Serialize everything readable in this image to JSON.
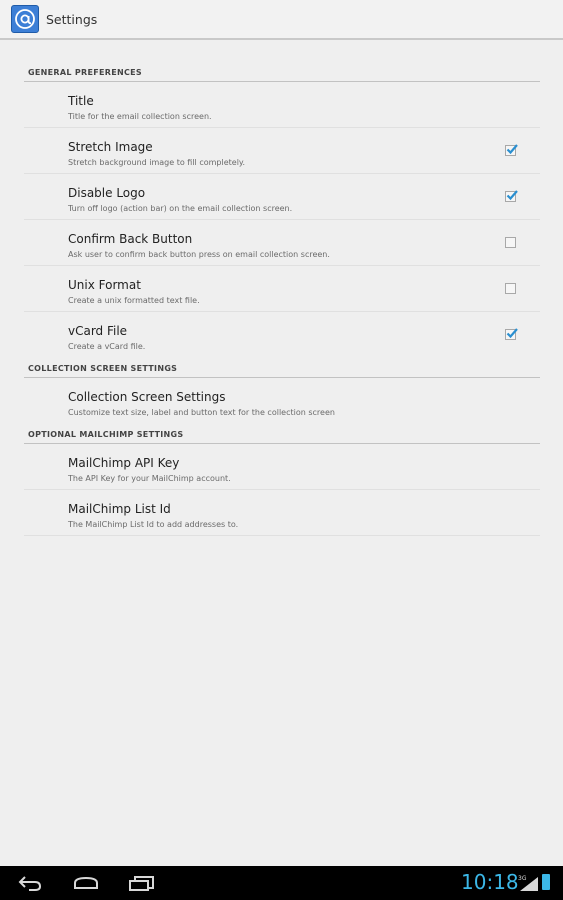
{
  "app": {
    "title": "Settings",
    "icon": "at-sign-icon"
  },
  "sections": [
    {
      "header": "GENERAL PREFERENCES",
      "items": [
        {
          "title": "Title",
          "summary": "Title for the email collection screen.",
          "checkbox": null
        },
        {
          "title": "Stretch Image",
          "summary": "Stretch background image to fill completely.",
          "checkbox": true
        },
        {
          "title": "Disable Logo",
          "summary": "Turn off logo (action bar) on the email collection screen.",
          "checkbox": true
        },
        {
          "title": "Confirm Back Button",
          "summary": "Ask user to confirm back button press on email collection screen.",
          "checkbox": false
        },
        {
          "title": "Unix Format",
          "summary": "Create a unix formatted text file.",
          "checkbox": false
        },
        {
          "title": "vCard File",
          "summary": "Create a vCard file.",
          "checkbox": true
        }
      ]
    },
    {
      "header": "COLLECTION SCREEN SETTINGS",
      "items": [
        {
          "title": "Collection Screen Settings",
          "summary": "Customize text size, label and button text for the collection screen",
          "checkbox": null
        }
      ]
    },
    {
      "header": "OPTIONAL MAILCHIMP SETTINGS",
      "items": [
        {
          "title": "MailChimp API Key",
          "summary": "The API Key for your MailChimp account.",
          "checkbox": null
        },
        {
          "title": "MailChimp List Id",
          "summary": "The MailChimp List Id to add addresses to.",
          "checkbox": null
        }
      ]
    }
  ],
  "status_bar": {
    "time": "10:18",
    "signal": "3G",
    "signal_icon": "signal-icon",
    "battery_icon": "battery-icon"
  },
  "nav": {
    "back_icon": "back-icon",
    "home_icon": "home-icon",
    "recents_icon": "recents-icon"
  },
  "colors": {
    "accent": "#3cb8e8",
    "check": "#2a8fd0",
    "app_icon": "#3d7fd6"
  }
}
